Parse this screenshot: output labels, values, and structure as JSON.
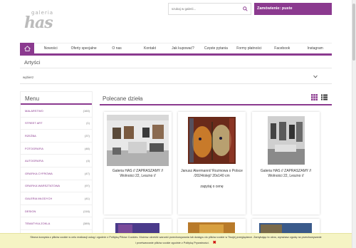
{
  "logo": {
    "small": "galeria",
    "big": "has"
  },
  "search": {
    "placeholder": "szukaj w galerii..."
  },
  "cart": {
    "label": "Zamówienie: puste"
  },
  "nav": {
    "items": [
      "Nowości",
      "Oferty specjalne",
      "O nas",
      "Kontakt",
      "Jak kupować?",
      "Częste pytania",
      "Formy płatności",
      "Facebook",
      "Instagram"
    ]
  },
  "artists": {
    "title": "Artyści",
    "selected": "wybierz"
  },
  "menu": {
    "title": "Menu",
    "items": [
      {
        "label": "MALARSTWO",
        "count": "(160)"
      },
      {
        "label": "STREET ART",
        "count": "(1)"
      },
      {
        "label": "RZEŹBA",
        "count": "(37)"
      },
      {
        "label": "FOTOGRAFIA",
        "count": "(48)"
      },
      {
        "label": "AUTOGRAFIA",
        "count": "(4)"
      },
      {
        "label": "GRAFIKA CYFROWA",
        "count": "(47)"
      },
      {
        "label": "GRAFIKA WARSZTATOWA",
        "count": "(97)"
      },
      {
        "label": "GALERIA MŁODYCH",
        "count": "(41)"
      },
      {
        "label": "DESIGN",
        "count": "(116)"
      },
      {
        "label": "TEMATYKA ZOKLA",
        "count": "(389)"
      }
    ]
  },
  "featured": {
    "title": "Polecane dzieła"
  },
  "cards": [
    {
      "text": "Galeria HAS // ZAPRASZAMY // Wolności 22, Leszno //",
      "extra": ""
    },
    {
      "text": "Janusz Akermann// Rozmowa o Polsce /2024/olej// 20x140 cm",
      "extra": "zapytaj o cenę"
    },
    {
      "text": "Galeria HAS // ZAPRASZAMY // Wolności 22, Leszno //",
      "extra": ""
    }
  ],
  "cookie": {
    "line1": "Strona korzysta z plików cookie w celu realizacji usług i zgodnie z Polityką Plików Cookies. Możesz określić warunki przechowywania lub dostępu do plików cookie w Twojej przeglądarce. Zamykając to okno, wyrażasz zgodę na przechowywanie",
    "line2": "i przetwarzanie plików cookie zgodnie z Polityką Prywatności."
  },
  "colors": {
    "accent": "#8b3a8f",
    "cookie_bg": "#f5f4c4"
  }
}
